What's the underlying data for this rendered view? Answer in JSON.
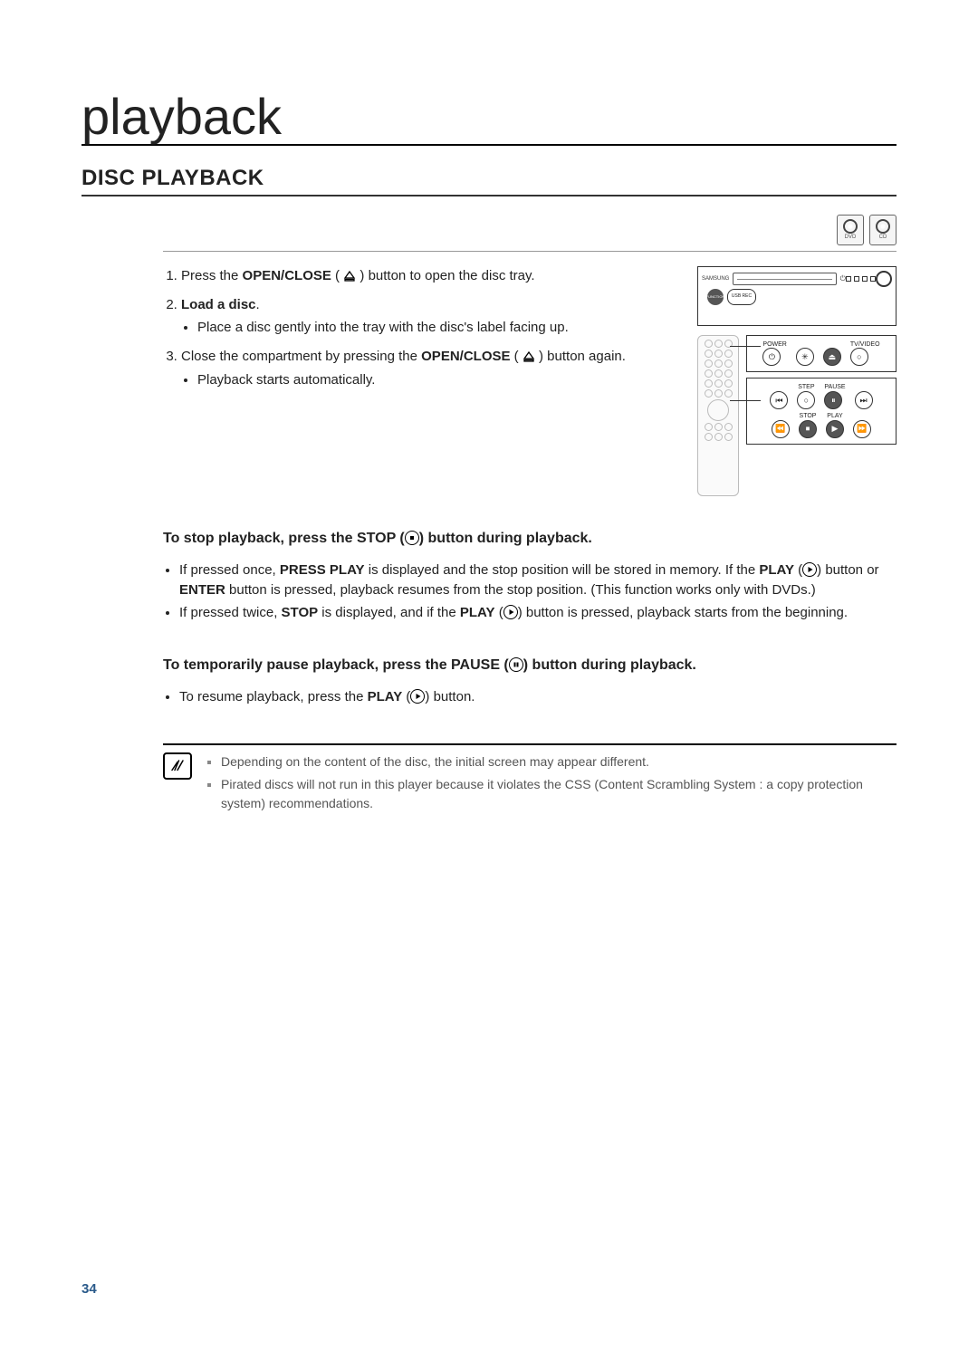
{
  "title": "playback",
  "subtitle": "DISC PLAYBACK",
  "disc_icons": [
    {
      "label": "DVD"
    },
    {
      "label": "CD"
    }
  ],
  "steps": {
    "s1_a": "Press the ",
    "s1_b": "OPEN/CLOSE",
    "s1_c": " (",
    "s1_d": ") button to open the disc tray.",
    "s2_title": "Load a disc",
    "s2_punct": ".",
    "s2_bullet": "Place a disc gently into the tray with the disc's label facing up.",
    "s3_a": "Close the compartment by pressing the ",
    "s3_b": "OPEN/CLOSE",
    "s3_c": " (",
    "s3_d": ") button again.",
    "s3_bullet": "Playback starts automatically."
  },
  "device": {
    "brand": "SAMSUNG",
    "function": "FUNCTION",
    "usb": "USB REC"
  },
  "remote": {
    "row1": {
      "power": "POWER",
      "tv": "TV/VIDEO"
    },
    "row2": {
      "step": "STEP",
      "pause": "PAUSE"
    },
    "row3": {
      "stop": "STOP",
      "play": "PLAY"
    }
  },
  "stop_block": {
    "title_a": "To stop playback, press the STOP (",
    "title_b": ") button during playback.",
    "b1_a": "If pressed once, ",
    "b1_b": "PRESS PLAY",
    "b1_c": " is displayed and the stop position will be stored in memory. If the ",
    "b1_d": "PLAY",
    "b1_e": " (",
    "b1_f": ") button or ",
    "b1_g": "ENTER",
    "b1_h": " button is pressed, playback resumes from the stop position. (This function works only with DVDs.)",
    "b2_a": "If pressed twice, ",
    "b2_b": "STOP",
    "b2_c": " is displayed, and if the ",
    "b2_d": "PLAY",
    "b2_e": " (",
    "b2_f": ") button is pressed, playback starts from the beginning."
  },
  "pause_block": {
    "title_a": "To temporarily pause playback, press the ",
    "title_b": "PAUSE (",
    "title_c": ") button during playback.",
    "b1_a": "To resume playback, press the ",
    "b1_b": "PLAY",
    "b1_c": " (",
    "b1_d": ") button."
  },
  "notes": {
    "n1": "Depending on the content of the disc, the initial screen may appear different.",
    "n2": "Pirated discs will not run in this player because it violates the CSS (Content Scrambling System : a copy protection system) recommendations."
  },
  "page_number": "34"
}
